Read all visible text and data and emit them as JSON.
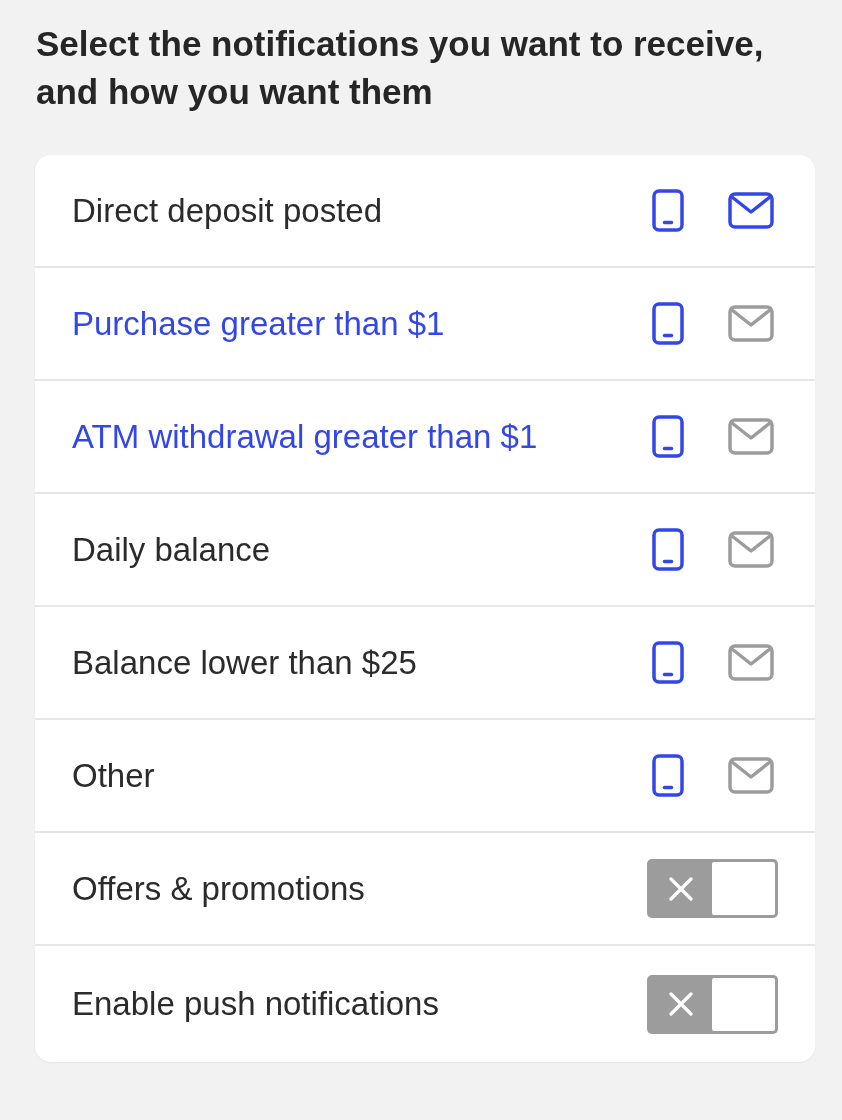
{
  "heading": "Select the notifications you want to receive, and how you want them",
  "rows": [
    {
      "kind": "channels",
      "label": "Direct deposit posted",
      "highlighted": false,
      "phone": true,
      "email": true
    },
    {
      "kind": "channels",
      "label": "Purchase greater than $1",
      "highlighted": true,
      "phone": true,
      "email": false
    },
    {
      "kind": "channels",
      "label": "ATM withdrawal greater than $1",
      "highlighted": true,
      "phone": true,
      "email": false
    },
    {
      "kind": "channels",
      "label": "Daily balance",
      "highlighted": false,
      "phone": true,
      "email": false
    },
    {
      "kind": "channels",
      "label": "Balance lower than $25",
      "highlighted": false,
      "phone": true,
      "email": false
    },
    {
      "kind": "channels",
      "label": "Other",
      "highlighted": false,
      "phone": true,
      "email": false
    },
    {
      "kind": "toggle",
      "label": "Offers & promotions",
      "highlighted": false,
      "on": false
    },
    {
      "kind": "toggle",
      "label": "Enable push notifications",
      "highlighted": false,
      "on": false
    }
  ]
}
